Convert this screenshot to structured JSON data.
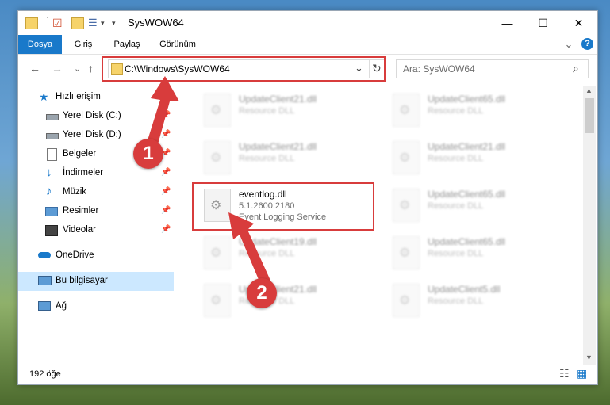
{
  "window": {
    "title": "SysWOW64",
    "min_glyph": "—",
    "max_glyph": "☐",
    "close_glyph": "✕"
  },
  "ribbon": {
    "tabs": [
      {
        "label": "Dosya",
        "active": true
      },
      {
        "label": "Giriş"
      },
      {
        "label": "Paylaş"
      },
      {
        "label": "Görünüm"
      }
    ],
    "expand_glyph": "⌄",
    "help_glyph": "?"
  },
  "nav": {
    "back_glyph": "←",
    "forward_glyph": "→",
    "history_glyph": "⌄",
    "up_glyph": "↑",
    "address": "C:\\Windows\\SysWOW64",
    "address_dropdown_glyph": "⌄",
    "refresh_glyph": "↻",
    "search_placeholder": "Ara: SysWOW64",
    "search_glyph": "⌕"
  },
  "sidebar": {
    "items": [
      {
        "label": "Hızlı erişim",
        "icon": "star-icon"
      },
      {
        "label": "Yerel Disk (C:)",
        "icon": "drive-icon"
      },
      {
        "label": "Yerel Disk (D:)",
        "icon": "drive-icon"
      },
      {
        "label": "Belgeler",
        "icon": "documents-icon"
      },
      {
        "label": "İndirmeler",
        "icon": "downloads-icon"
      },
      {
        "label": "Müzik",
        "icon": "music-icon"
      },
      {
        "label": "Resimler",
        "icon": "pictures-icon"
      },
      {
        "label": "Videolar",
        "icon": "videos-icon"
      },
      {
        "label": "OneDrive",
        "icon": "cloud-icon"
      },
      {
        "label": "Bu bilgisayar",
        "icon": "computer-icon"
      },
      {
        "label": "Ağ",
        "icon": "network-icon"
      }
    ],
    "pin_glyph": "📌"
  },
  "files": {
    "left": [
      {
        "name": "UpdateClient21.dll",
        "l1": "Resource DLL",
        "l2": ""
      },
      {
        "name": "UpdateClient21.dll",
        "l1": "Resource DLL",
        "l2": ""
      },
      {
        "name": "eventlog.dll",
        "l1": "5.1.2600.2180",
        "l2": "Event Logging Service"
      },
      {
        "name": "UpdateClient19.dll",
        "l1": "Resource DLL",
        "l2": ""
      },
      {
        "name": "UpdateClient21.dll",
        "l1": "Resource DLL",
        "l2": ""
      }
    ],
    "right": [
      {
        "name": "UpdateClient65.dll",
        "l1": "Resource DLL",
        "l2": ""
      },
      {
        "name": "UpdateClient21.dll",
        "l1": "Resource DLL",
        "l2": ""
      },
      {
        "name": "UpdateClient65.dll",
        "l1": "Resource DLL",
        "l2": ""
      },
      {
        "name": "UpdateClient65.dll",
        "l1": "Resource DLL",
        "l2": ""
      },
      {
        "name": "UpdateClient5.dll",
        "l1": "Resource DLL",
        "l2": ""
      }
    ]
  },
  "status": {
    "count": "192 öğe",
    "details_view_glyph": "☷",
    "tiles_view_glyph": "▦"
  },
  "annotations": {
    "step1": "1",
    "step2": "2",
    "color": "#d83c3c"
  },
  "colors": {
    "accent": "#1979ca",
    "selection": "#cce8ff"
  }
}
